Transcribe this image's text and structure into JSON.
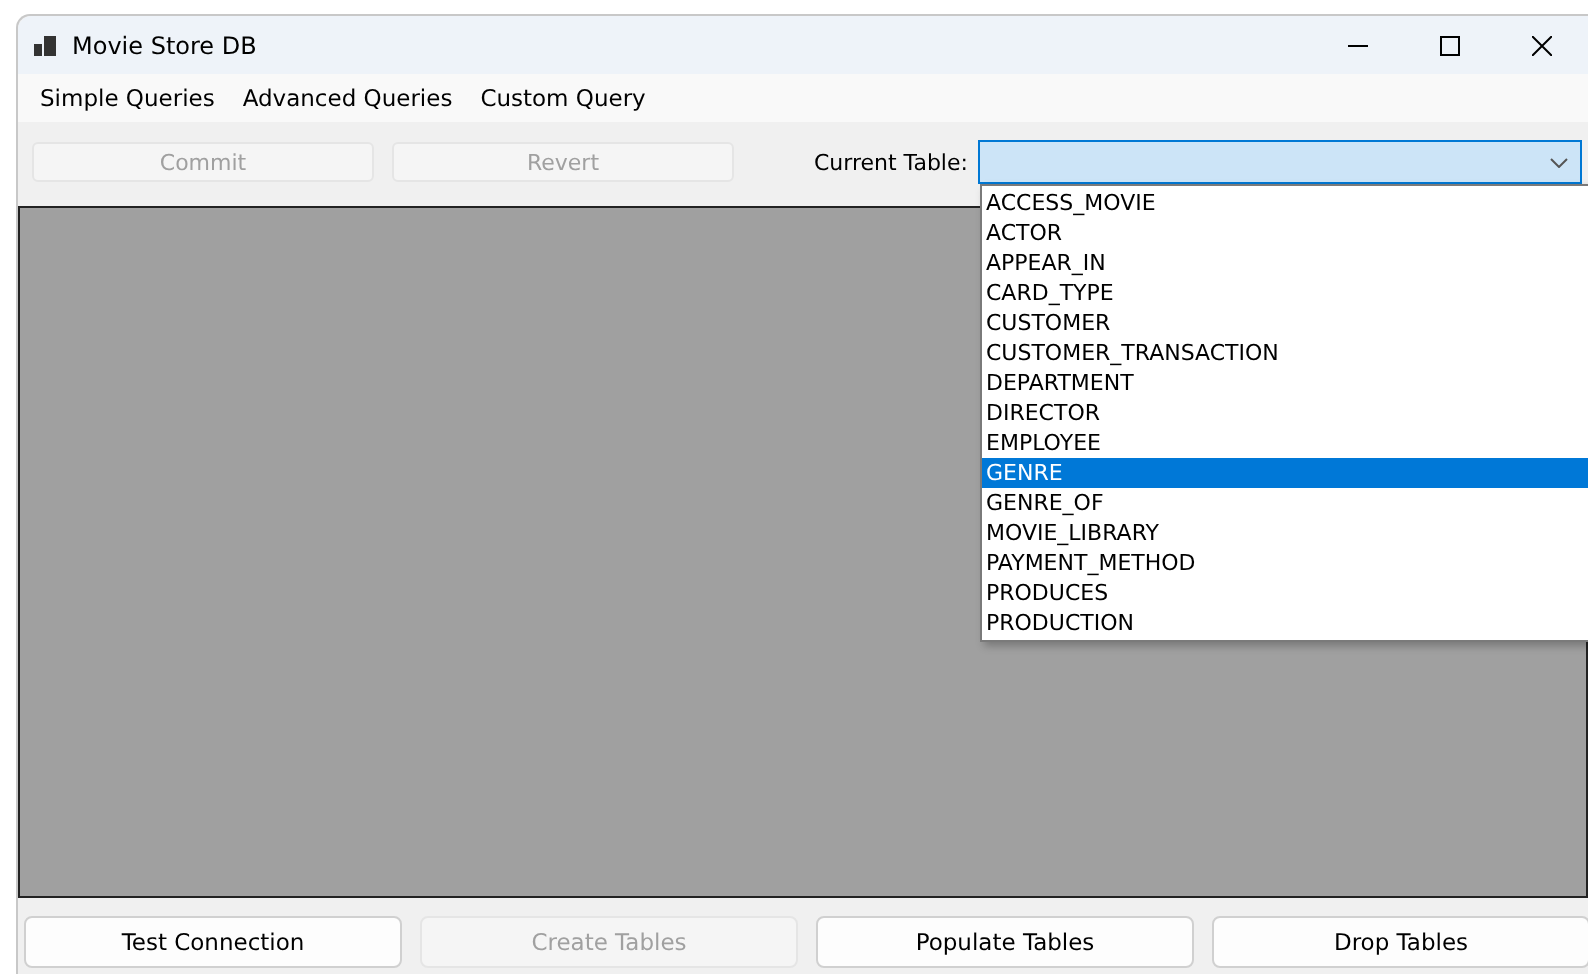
{
  "window": {
    "title": "Movie Store DB"
  },
  "menu": [
    "Simple Queries",
    "Advanced Queries",
    "Custom Query"
  ],
  "toolbar": {
    "buttons": [
      {
        "label": "Commit",
        "disabled": true
      },
      {
        "label": "Revert",
        "disabled": true
      }
    ],
    "table_label": "Current Table:"
  },
  "table_dropdown": {
    "expanded": true,
    "options": [
      {
        "label": "ACCESS_MOVIE",
        "selected": false
      },
      {
        "label": "ACTOR",
        "selected": false
      },
      {
        "label": "APPEAR_IN",
        "selected": false
      },
      {
        "label": "CARD_TYPE",
        "selected": false
      },
      {
        "label": "CUSTOMER",
        "selected": false
      },
      {
        "label": "CUSTOMER_TRANSACTION",
        "selected": false
      },
      {
        "label": "DEPARTMENT",
        "selected": false
      },
      {
        "label": "DIRECTOR",
        "selected": false
      },
      {
        "label": "EMPLOYEE",
        "selected": false
      },
      {
        "label": "GENRE",
        "selected": true
      },
      {
        "label": "GENRE_OF",
        "selected": false
      },
      {
        "label": "MOVIE_LIBRARY",
        "selected": false
      },
      {
        "label": "PAYMENT_METHOD",
        "selected": false
      },
      {
        "label": "PRODUCES",
        "selected": false
      },
      {
        "label": "PRODUCTION",
        "selected": false
      }
    ]
  },
  "bottom_buttons": [
    {
      "label": "Test Connection",
      "disabled": false
    },
    {
      "label": "Create Tables",
      "disabled": true
    },
    {
      "label": "Populate Tables",
      "disabled": false
    },
    {
      "label": "Drop Tables",
      "disabled": false
    }
  ]
}
